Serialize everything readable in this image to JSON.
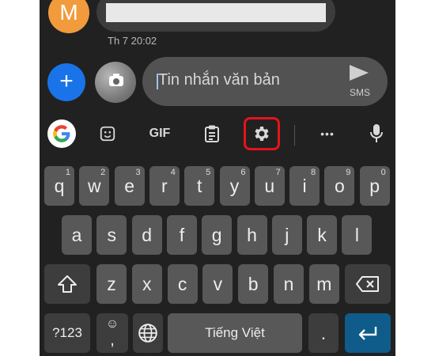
{
  "conversation": {
    "contact_initial": "M",
    "last_message_time": "Th 7 20:02"
  },
  "compose": {
    "placeholder": "Tin nhắn văn bản",
    "send_label": "SMS"
  },
  "keyboard_toolbar": {
    "items": [
      "google-icon",
      "sticker-icon",
      "gif-button",
      "clipboard-icon",
      "settings-icon",
      "more-icon",
      "microphone-icon"
    ],
    "gif_label": "GIF",
    "more_label": "•••",
    "highlight_color": "#e4141a"
  },
  "keyboard": {
    "row1": [
      {
        "key": "q",
        "hint": "1"
      },
      {
        "key": "w",
        "hint": "2"
      },
      {
        "key": "e",
        "hint": "3"
      },
      {
        "key": "r",
        "hint": "4"
      },
      {
        "key": "t",
        "hint": "5"
      },
      {
        "key": "y",
        "hint": "6"
      },
      {
        "key": "u",
        "hint": "7"
      },
      {
        "key": "i",
        "hint": "8"
      },
      {
        "key": "o",
        "hint": "9"
      },
      {
        "key": "p",
        "hint": "0"
      }
    ],
    "row2": [
      "a",
      "s",
      "d",
      "f",
      "g",
      "h",
      "j",
      "k",
      "l"
    ],
    "row3": [
      "z",
      "x",
      "c",
      "v",
      "b",
      "n",
      "m"
    ],
    "symbols_label": "?123",
    "emoji_label": "☺",
    "comma_label": ",",
    "space_label": "Tiếng Việt",
    "period_label": "."
  },
  "colors": {
    "background": "#212121",
    "key": "#585858",
    "enter_key": "#0f5b8a",
    "compose_button": "#1a73e8",
    "avatar": "#f19b3d"
  }
}
